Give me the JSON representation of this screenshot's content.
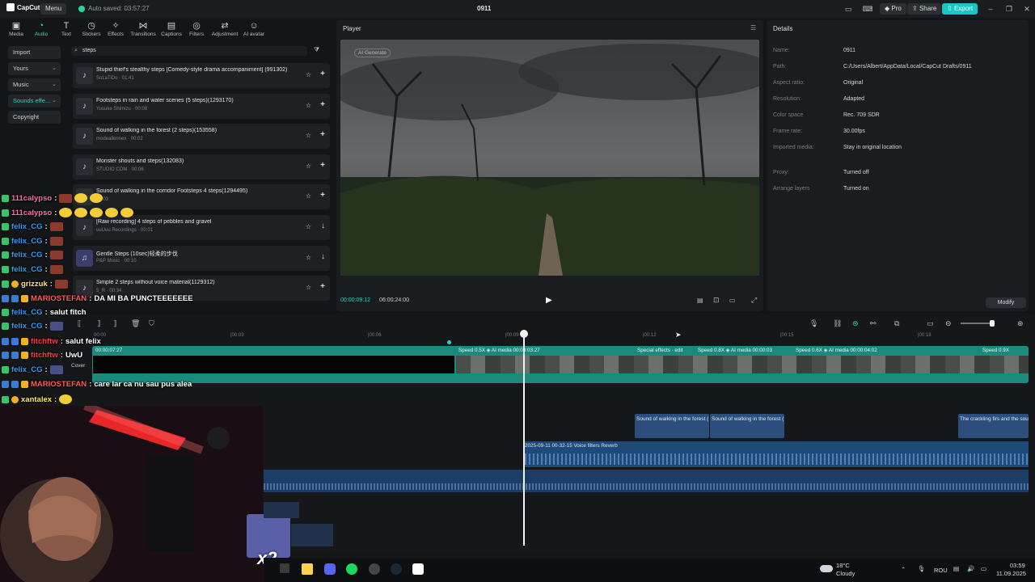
{
  "topbar": {
    "logo": "CapCut",
    "menu": "Menu",
    "autosave": "Auto saved: 03:57:27",
    "project_title": "0911",
    "pro": "Pro",
    "share": "Share",
    "export": "Export"
  },
  "tools": [
    {
      "label": "Media",
      "icon": "media-icon"
    },
    {
      "label": "Audio",
      "icon": "audio-icon"
    },
    {
      "label": "Text",
      "icon": "text-icon"
    },
    {
      "label": "Stickers",
      "icon": "stickers-icon"
    },
    {
      "label": "Effects",
      "icon": "effects-icon"
    },
    {
      "label": "Transitions",
      "icon": "transitions-icon"
    },
    {
      "label": "Captions",
      "icon": "captions-icon"
    },
    {
      "label": "Filters",
      "icon": "filters-icon"
    },
    {
      "label": "Adjustment",
      "icon": "adjustment-icon"
    },
    {
      "label": "AI avatar",
      "icon": "ai-avatar-icon"
    }
  ],
  "sidebar": {
    "items": [
      "Import",
      "Yours",
      "Music",
      "Sounds effe...",
      "Copyright"
    ]
  },
  "search": {
    "value": "steps"
  },
  "sounds": [
    {
      "title": "Stupid thief's stealthy steps [Comedy-style drama accompaniment] (991302)",
      "meta": "SoLaTiDo · 01:41",
      "action": "+"
    },
    {
      "title": "Footsteps in rain and water scenes (5 steps)(1293170)",
      "meta": "Yusuke Shimizu · 00:08",
      "action": "+"
    },
    {
      "title": "Sound of walking in the forest (2 steps)(153558)",
      "meta": "modeallennex · 00:02",
      "action": "+"
    },
    {
      "title": "Monster shouts and steps(132083)",
      "meta": "STUDIO COM · 00:06",
      "action": "+"
    },
    {
      "title": "Sound of walking in the corridor Footsteps 4 steps(1294495)",
      "meta": "00:03",
      "action": "+"
    },
    {
      "title": "[Raw recording] 4 steps of pebbles and gravel",
      "meta": "uuUuu Recordings · 00:01",
      "action": "↓"
    },
    {
      "title": "Gentle Steps (10sec)轻柔的步伐",
      "meta": "P&P Music · 00:10",
      "action": "↓"
    },
    {
      "title": "Simple 2 steps without voice material(1129312)",
      "meta": "5_R · 00:34",
      "action": "+"
    }
  ],
  "player": {
    "title": "Player",
    "ai_generate": "AI Generate",
    "current_time": "00:00:09:12",
    "total_time": "06:00:24:00"
  },
  "details": {
    "title": "Details",
    "rows": [
      {
        "label": "Name:",
        "value": "0911"
      },
      {
        "label": "Path:",
        "value": "C:/Users/Albert/AppData/Local/CapCut Drafts/0911"
      },
      {
        "label": "Aspect ratio:",
        "value": "Original"
      },
      {
        "label": "Resolution:",
        "value": "Adapted"
      },
      {
        "label": "Color space",
        "value": "Rec. 709 SDR"
      },
      {
        "label": "Frame rate:",
        "value": "30.00fps"
      },
      {
        "label": "Imported media:",
        "value": "Stay in original location"
      },
      {
        "label": "Proxy:",
        "value": "Turned off"
      },
      {
        "label": "Arrange layers",
        "value": "Turned on"
      }
    ],
    "modify": "Modify"
  },
  "timeline": {
    "ruler": [
      "00:00",
      "|00:03",
      "|00:06",
      "|00:09",
      "|00:12",
      "|00:15",
      "|00:18"
    ],
    "video_segments": [
      {
        "label": "00:00:07:27"
      },
      {
        "label": "Speed 0.5X  ◈ AI media  00:00:03:27"
      },
      {
        "label": "Special effects · edit"
      },
      {
        "label": "Speed 0.8X  ◈ AI media  00:00:03"
      },
      {
        "label": "Speed 0.6X  ◈ AI media  00:00:04:02"
      },
      {
        "label": "Speed 0.9X"
      }
    ],
    "audio_clips": [
      "Sound of walking in the forest (",
      "Sound of walking in the forest (",
      "The crackling firs and the sou"
    ],
    "voice_track": "2025-09-11 00-32-15   Voice filters Reverb",
    "cover": "Cover"
  },
  "chat": [
    {
      "user": "111calypso",
      "msg": "",
      "color": "#ff6aa8"
    },
    {
      "user": "111calypso",
      "msg": "",
      "color": "#ff6aa8"
    },
    {
      "user": "felix_CG",
      "msg": "",
      "color": "#2e9cff"
    },
    {
      "user": "felix_CG",
      "msg": "",
      "color": "#2e9cff"
    },
    {
      "user": "felix_CG",
      "msg": "",
      "color": "#2e9cff"
    },
    {
      "user": "felix_CG",
      "msg": "",
      "color": "#2e9cff"
    },
    {
      "user": "grizzuk",
      "msg": "",
      "color": "#ffe36a"
    },
    {
      "user": "MARIOSTEFAN",
      "msg": "DA MI BA PUNCTEEEEEEE",
      "color": "#ff5a5a"
    },
    {
      "user": "felix_CG",
      "msg": "salut fitch",
      "color": "#2e9cff"
    },
    {
      "user": "felix_CG",
      "msg": "",
      "color": "#2e9cff"
    },
    {
      "user": "fitchftw",
      "msg": "salut felix",
      "color": "#ff3b3b"
    },
    {
      "user": "fitchftw",
      "msg": "UwU",
      "color": "#ff3b3b"
    },
    {
      "user": "felix_CG",
      "msg": "",
      "color": "#2e9cff"
    },
    {
      "user": "MARIOSTEFAN",
      "msg": "care lar ca nu sau pus alea",
      "color": "#ff5a5a"
    },
    {
      "user": "xantalex",
      "msg": "",
      "color": "#ffe36a"
    }
  ],
  "taskbar": {
    "weather_temp": "18°C",
    "weather_desc": "Cloudy",
    "lang": "ROU",
    "time": "03:59",
    "date": "11.09.2025"
  },
  "overlay": {
    "multiplier": "x2"
  }
}
